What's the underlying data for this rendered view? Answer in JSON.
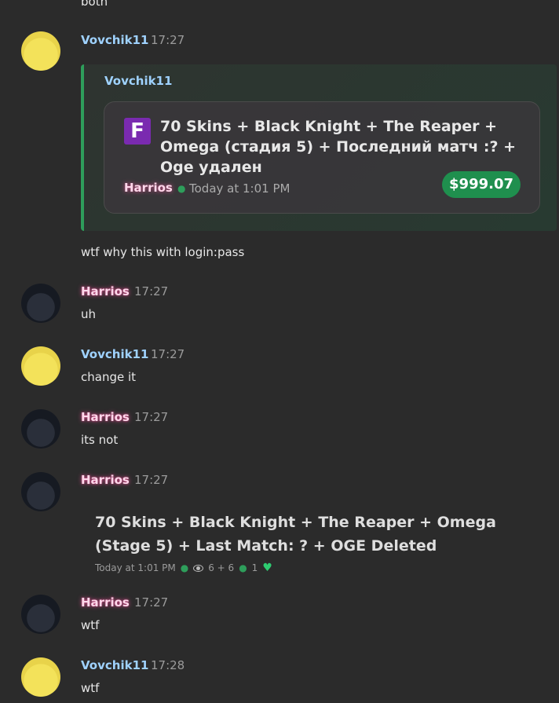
{
  "top_fragment": "both",
  "messages": [
    {
      "author": "Vovchik11",
      "time": "17:27"
    },
    {
      "author": "Harrios",
      "time": "17:27",
      "text": "uh"
    },
    {
      "author": "Vovchik11",
      "time": "17:27",
      "text": "change it"
    },
    {
      "author": "Harrios",
      "time": "17:27",
      "text": "its not"
    },
    {
      "author": "Harrios",
      "time": "17:27"
    },
    {
      "author": "Harrios",
      "time": "17:27",
      "text": "wtf"
    },
    {
      "author": "Vovchik11",
      "time": "17:28",
      "text": "wtf"
    }
  ],
  "embed": {
    "author": "Vovchik11",
    "title": "70 Skins + Black Knight + The Reaper + Omega (стадия 5) + Последний матч :? + Oge удален",
    "seller": "Harrios",
    "time": "Today at 1:01 PM",
    "price": "$999.07",
    "icon": "fortnite-icon"
  },
  "embed_followup_text": "wtf why this with login:pass",
  "listing": {
    "title": "70 Skins + Black Knight + The Reaper + Omega (Stage 5) + Last Match: ? + OGE Deleted",
    "time": "Today at 1:01 PM",
    "views": "6 + 6",
    "likes": "1",
    "like_icon": "heart-icon",
    "views_icon": "eye-icon"
  },
  "colors": {
    "accent": "#2e9e5b",
    "vovchik": "#9fd2ff",
    "harrios": "#ffd7ea"
  }
}
